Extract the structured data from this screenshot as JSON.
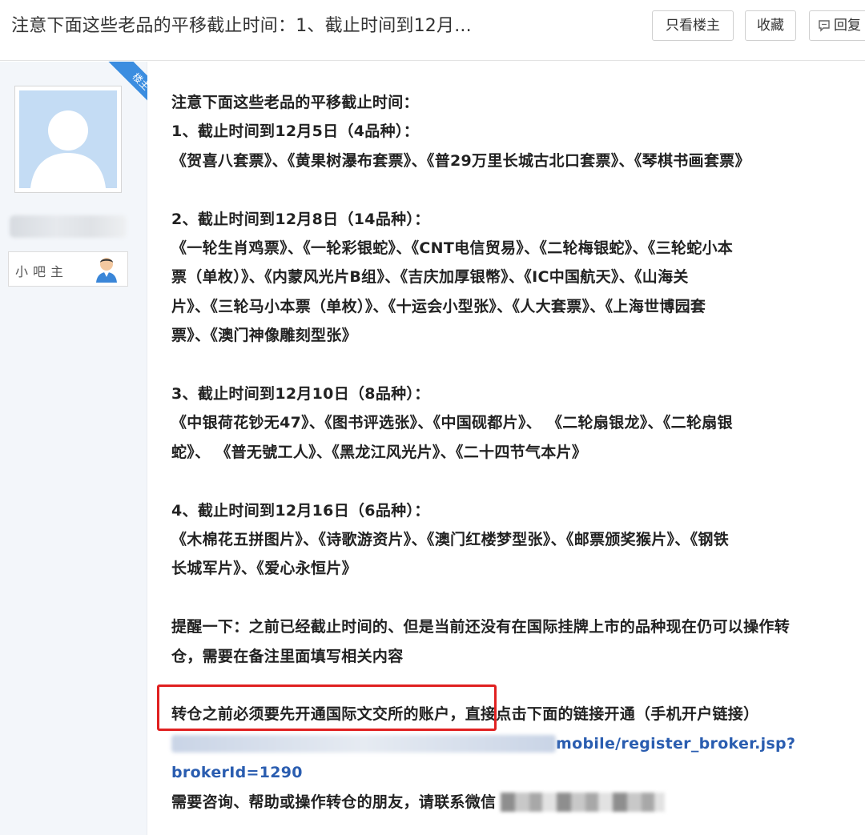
{
  "header": {
    "title": "注意下面这些老品的平移截止时间：1、截止时间到12月...",
    "btn_only_author": "只看楼主",
    "btn_favorite": "收藏",
    "btn_reply": "回复"
  },
  "user": {
    "ribbon": "楼主",
    "badge_label": "小吧主"
  },
  "post": {
    "intro": "注意下面这些老品的平移截止时间：",
    "s1_head": "1、截止时间到12月5日（4品种）：",
    "s1_l1": "《贺喜八套票》、《黄果树瀑布套票》、《普29万里长城古北口套票》、《琴棋书画套票》",
    "s2_head": "2、截止时间到12月8日（14品种）：",
    "s2_l1": "《一轮生肖鸡票》、《一轮彩银蛇》、《CNT电信贸易》、《二轮梅银蛇》、《三轮蛇小本",
    "s2_l2": "票（单枚）》、《内蒙风光片B组》、《吉庆加厚银幣》、《IC中国航天》、《山海关",
    "s2_l3": "片》、《三轮马小本票（单枚）》、《十运会小型张》、《人大套票》、《上海世博园套",
    "s2_l4": "票》、《澳门神像雕刻型张》",
    "s3_head": "3、截止时间到12月10日（8品种）：",
    "s3_l1": "《中银荷花钞无47》、《图书评选张》、《中国砚都片》、 《二轮扇银龙》、《二轮扇银",
    "s3_l2": "蛇》、 《普无號工人》、《黑龙江风光片》、《二十四节气本片》",
    "s4_head": "4、截止时间到12月16日（6品种）：",
    "s4_l1": "《木棉花五拼图片》、《诗歌游资片》、《澳门红楼梦型张》、《邮票颁奖猴片》、《钢铁",
    "s4_l2": "长城军片》、《爱心永恒片》",
    "remind_l1": "提醒一下：之前已经截止时间的、但是当前还没有在国际挂牌上市的品种现在仍可以操作转",
    "remind_l2": "仓，需要在备注里面填写相关内容",
    "highlight_text": "转仓之前必须要先开通国际文交所的账户，",
    "after_highlight": "直接点击下面的链接开通（手机开户链接）",
    "link_visible_a": "mobile/register_broker.jsp?",
    "link_visible_b": "brokerId=1290",
    "contact": "需要咨询、帮助或操作转仓的朋友，请联系微信"
  }
}
